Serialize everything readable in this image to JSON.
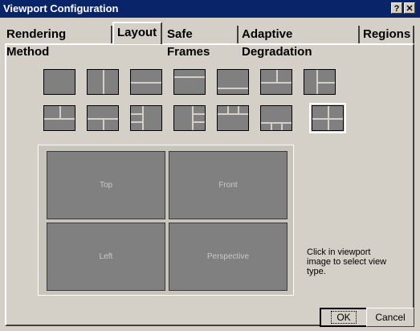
{
  "window": {
    "title": "Viewport Configuration",
    "help_label": "?",
    "close_label": "✕"
  },
  "tabs": [
    {
      "label": "Rendering Method",
      "active": false
    },
    {
      "label": "Layout",
      "active": true
    },
    {
      "label": "Safe Frames",
      "active": false
    },
    {
      "label": "Adaptive Degradation",
      "active": false
    },
    {
      "label": "Regions",
      "active": false
    }
  ],
  "preview": {
    "viewports": [
      "Top",
      "Front",
      "Left",
      "Perspective"
    ]
  },
  "hint_text": "Click in viewport image to select view type.",
  "buttons": {
    "ok": "OK",
    "cancel": "Cancel"
  }
}
